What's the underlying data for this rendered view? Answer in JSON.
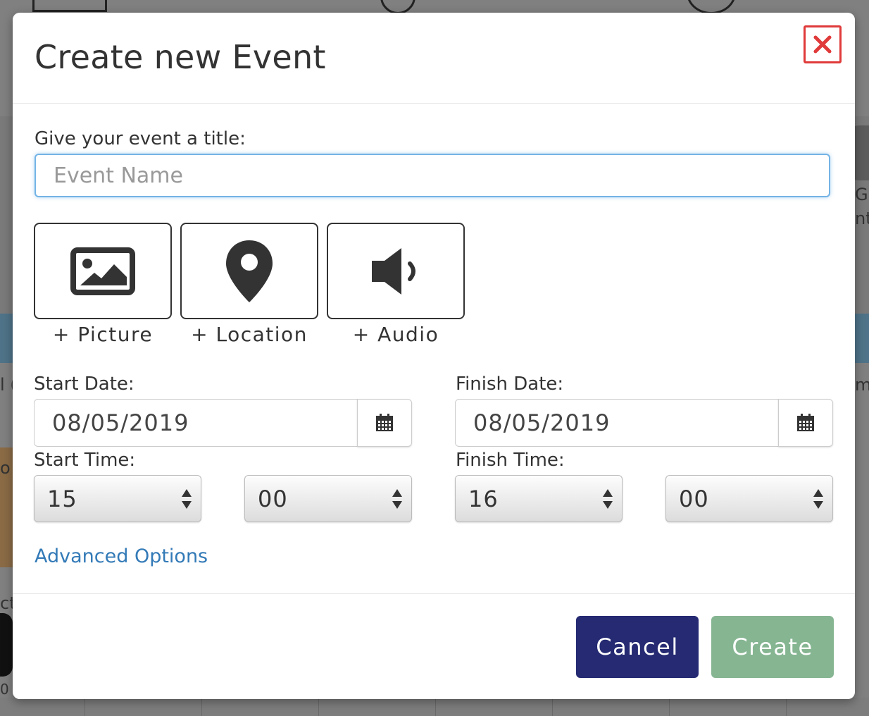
{
  "background": {
    "fragments": [
      "l (",
      "o",
      "Gr",
      "nt",
      "m",
      "ct",
      "0"
    ]
  },
  "modal": {
    "title": "Create new Event",
    "close_icon": "close-x-icon",
    "title_label": "Give your event a title:",
    "title_input": {
      "value": "",
      "placeholder": "Event Name"
    },
    "media": [
      {
        "label": "+ Picture",
        "icon": "picture-icon"
      },
      {
        "label": "+ Location",
        "icon": "map-marker-icon"
      },
      {
        "label": "+ Audio",
        "icon": "volume-icon"
      }
    ],
    "start_date": {
      "label": "Start Date:",
      "value": "08/05/2019",
      "icon": "calendar-icon"
    },
    "finish_date": {
      "label": "Finish Date:",
      "value": "08/05/2019",
      "icon": "calendar-icon"
    },
    "start_time": {
      "label": "Start Time:",
      "hour": "15",
      "minute": "00"
    },
    "finish_time": {
      "label": "Finish Time:",
      "hour": "16",
      "minute": "00"
    },
    "advanced_options": "Advanced Options",
    "buttons": {
      "cancel": "Cancel",
      "create": "Create"
    },
    "colors": {
      "cancel_bg": "#252a72",
      "create_bg": "#86b592",
      "close_red": "#e03a3a",
      "link": "#337ab7",
      "focus_border": "#74b4e6"
    }
  }
}
